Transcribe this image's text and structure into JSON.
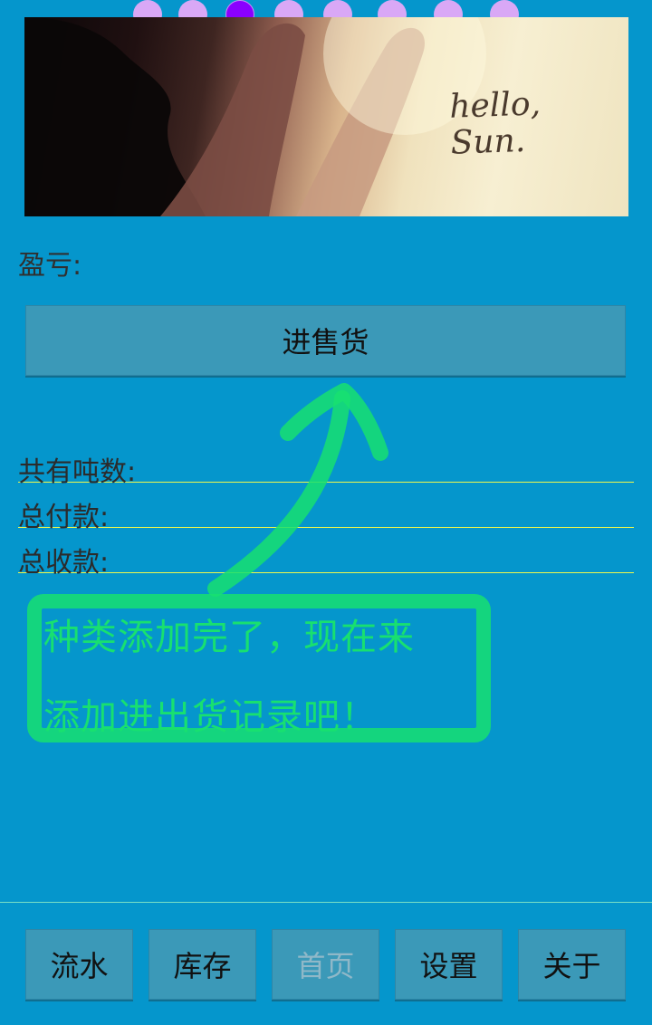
{
  "pager": {
    "count": 8,
    "active_index": 2
  },
  "banner": {
    "text": "hello,\nSun."
  },
  "profit": {
    "label": "盈亏:"
  },
  "main_button": {
    "label": "进售货"
  },
  "stats": [
    {
      "label": "共有吨数:"
    },
    {
      "label": "总付款:"
    },
    {
      "label": "总收款:"
    }
  ],
  "hint": {
    "text": "种类添加完了，现在来\n添加进出货记录吧！"
  },
  "tabs": [
    {
      "label": "流水",
      "enabled": true
    },
    {
      "label": "库存",
      "enabled": true
    },
    {
      "label": "首页",
      "enabled": false
    },
    {
      "label": "设置",
      "enabled": true
    },
    {
      "label": "关于",
      "enabled": true
    }
  ],
  "colors": {
    "background": "#0596cc",
    "highlight": "#18e070",
    "active_dot": "#8a00ff",
    "inactive_dot": "#d9a8f6"
  }
}
